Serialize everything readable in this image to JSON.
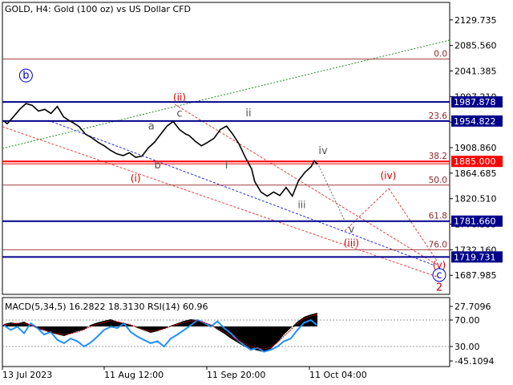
{
  "chart_data": [
    {
      "type": "line",
      "title": "GOLD, H4:  Gold (100 oz) vs US Dollar CFD",
      "ylim": [
        1655,
        2160
      ],
      "price_axis_ticks": [
        "2129.735",
        "2085.560",
        "2041.385",
        "1997.210",
        "1953.035",
        "1908.860",
        "1864.685",
        "1820.510",
        "1776.335",
        "1732.160",
        "1687.985"
      ],
      "time_axis_labels": [
        "13 Jul 2023",
        "11 Aug 12:00",
        "11 Sep 20:00",
        "11 Oct 04:00"
      ],
      "series": [
        {
          "x": [
            0,
            1,
            3,
            5,
            7,
            9,
            11,
            13,
            15,
            17,
            19,
            21,
            22,
            24,
            26,
            28,
            30,
            32,
            34,
            36,
            38,
            40,
            42,
            44,
            46,
            48,
            50,
            52,
            54,
            56,
            58,
            59,
            61,
            63,
            65,
            67,
            69,
            71,
            73,
            75,
            77,
            79,
            80,
            82,
            84,
            86,
            88,
            90,
            92,
            94,
            96,
            98,
            99,
            100
          ],
          "y": [
            1955,
            1950,
            1962,
            1975,
            1985,
            1982,
            1972,
            1975,
            1968,
            1980,
            1962,
            1955,
            1952,
            1945,
            1932,
            1926,
            1918,
            1912,
            1904,
            1898,
            1895,
            1900,
            1892,
            1894,
            1908,
            1918,
            1932,
            1946,
            1954,
            1940,
            1932,
            1930,
            1920,
            1912,
            1918,
            1925,
            1940,
            1946,
            1932,
            1915,
            1892,
            1872,
            1850,
            1832,
            1825,
            1832,
            1826,
            1840,
            1825,
            1852,
            1866,
            1876,
            1886,
            1880
          ]
        }
      ],
      "fib_levels": [
        {
          "label": "0.0",
          "value": 2062
        },
        {
          "label": "23.6",
          "value": 1954.822
        },
        {
          "label": "38.2",
          "value": 1885.0
        },
        {
          "label": "50.0",
          "value": 1844
        },
        {
          "label": "61.8",
          "value": 1781.66
        },
        {
          "label": "76.0",
          "value": 1732.16
        }
      ],
      "horizontal_lines": [
        {
          "value": 1987.878,
          "label": "1987.878",
          "color": "#00008b"
        },
        {
          "value": 1954.822,
          "label": "1954.822",
          "color": "#00008b"
        },
        {
          "value": 1885.0,
          "label": "1885.000",
          "color": "#ff0000"
        },
        {
          "value": 1781.66,
          "label": "1781.660",
          "color": "#00008b"
        },
        {
          "value": 1719.731,
          "label": "1719.731",
          "color": "#00008b"
        }
      ],
      "wave_labels": [
        {
          "label": "b",
          "style": "circled",
          "color": "#0000cc",
          "x": 7,
          "y": 2028
        },
        {
          "label": "(ii)",
          "color": "#cc0000",
          "x": 56,
          "y": 1990
        },
        {
          "label": "c",
          "color": "#555555",
          "x": 56,
          "y": 1962
        },
        {
          "label": "a",
          "color": "#555555",
          "x": 47,
          "y": 1940
        },
        {
          "label": "ii",
          "color": "#555555",
          "x": 78,
          "y": 1963
        },
        {
          "label": "b",
          "color": "#555555",
          "x": 49,
          "y": 1873
        },
        {
          "label": "i",
          "color": "#555555",
          "x": 71,
          "y": 1873
        },
        {
          "label": "(i)",
          "color": "#cc0000",
          "x": 42,
          "y": 1850
        },
        {
          "label": "iii",
          "color": "#555555",
          "x": 95,
          "y": 1804
        },
        {
          "label": "iv",
          "color": "#555555",
          "x": 102,
          "y": 1898
        },
        {
          "label": "v",
          "color": "#555555",
          "x": 112,
          "y": 1762
        },
        {
          "label": "(iii)",
          "color": "#cc0000",
          "x": 112,
          "y": 1738
        },
        {
          "label": "(iv)",
          "color": "#cc0000",
          "x": 125,
          "y": 1855
        },
        {
          "label": "(v)",
          "color": "#cc0000",
          "x": 143,
          "y": 1700
        },
        {
          "label": "c",
          "style": "circled",
          "color": "#0000cc",
          "x": 143,
          "y": 1683
        },
        {
          "label": "2",
          "color": "#cc0000",
          "x": 143,
          "y": 1661
        }
      ]
    },
    {
      "type": "line",
      "title": "MACD(5,34,5) 16.2822 18.3130 RSI(14) 60.96",
      "axis_ticks": [
        "27.7096",
        "70.00",
        "30.00",
        "-45.1094"
      ],
      "rsi_levels": [
        70,
        30
      ]
    }
  ]
}
